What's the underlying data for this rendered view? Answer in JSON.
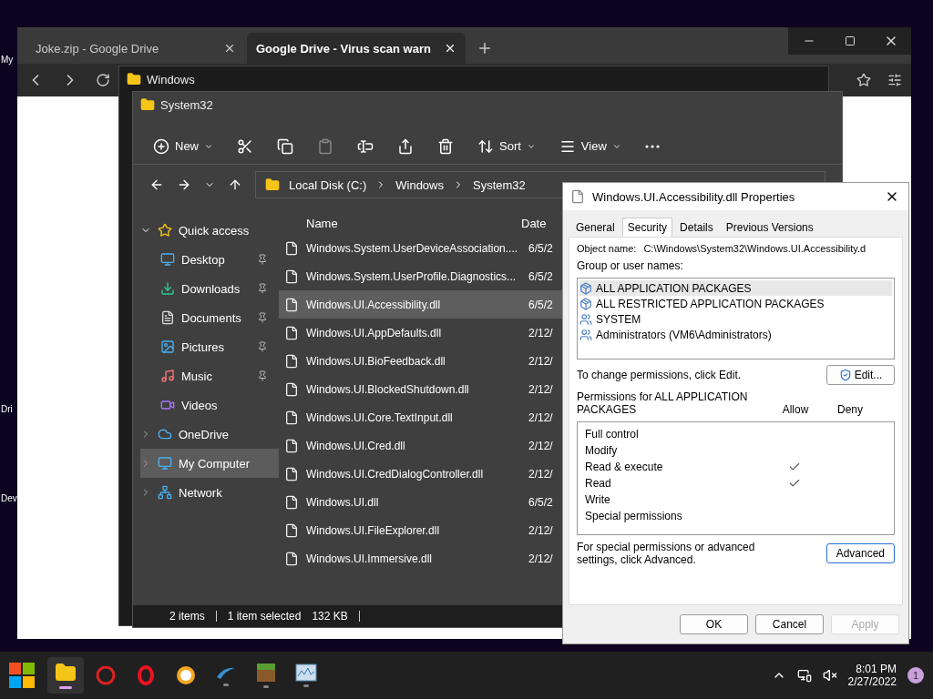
{
  "desktop": {
    "icons": [
      {
        "label": "My"
      },
      {
        "label": "Dri"
      },
      {
        "label": "Dev"
      }
    ]
  },
  "browser": {
    "tabs": [
      {
        "title": "Joke.zip - Google Drive",
        "selected": false
      },
      {
        "title": "Google Drive - Virus scan warn",
        "selected": true
      }
    ]
  },
  "back_window": {
    "title": "Windows"
  },
  "explorer": {
    "title": "System32",
    "commands": [
      {
        "kind": "new",
        "label": "New"
      },
      {
        "kind": "cut"
      },
      {
        "kind": "copy"
      },
      {
        "kind": "paste",
        "disabled": true
      },
      {
        "kind": "rename"
      },
      {
        "kind": "share"
      },
      {
        "kind": "delete"
      },
      {
        "kind": "sort",
        "label": "Sort"
      },
      {
        "kind": "view",
        "label": "View"
      },
      {
        "kind": "more"
      }
    ],
    "breadcrumb": [
      "Local Disk (C:)",
      "Windows",
      "System32"
    ],
    "sidebar": [
      {
        "kind": "star",
        "label": "Quick access",
        "expanded": true,
        "selected": false,
        "children": [
          {
            "kind": "desktop",
            "label": "Desktop",
            "pinned": true
          },
          {
            "kind": "downloads",
            "label": "Downloads",
            "pinned": true
          },
          {
            "kind": "documents",
            "label": "Documents",
            "pinned": true
          },
          {
            "kind": "pictures",
            "label": "Pictures",
            "pinned": true
          },
          {
            "kind": "music",
            "label": "Music",
            "pinned": true
          },
          {
            "kind": "videos",
            "label": "Videos",
            "pinned": false
          }
        ]
      },
      {
        "kind": "cloud",
        "label": "OneDrive",
        "expanded": false,
        "selected": false
      },
      {
        "kind": "computer",
        "label": "My Computer",
        "expanded": false,
        "selected": true
      },
      {
        "kind": "network",
        "label": "Network",
        "expanded": false,
        "selected": false
      }
    ],
    "columns": [
      "Name",
      "Date"
    ],
    "files": [
      {
        "name": "Windows.System.UserDeviceAssociation....",
        "date": "6/5/2",
        "selected": false
      },
      {
        "name": "Windows.System.UserProfile.Diagnostics...",
        "date": "6/5/2",
        "selected": false
      },
      {
        "name": "Windows.UI.Accessibility.dll",
        "date": "6/5/2",
        "selected": true
      },
      {
        "name": "Windows.UI.AppDefaults.dll",
        "date": "2/12/",
        "selected": false
      },
      {
        "name": "Windows.UI.BioFeedback.dll",
        "date": "2/12/",
        "selected": false
      },
      {
        "name": "Windows.UI.BlockedShutdown.dll",
        "date": "2/12/",
        "selected": false
      },
      {
        "name": "Windows.UI.Core.TextInput.dll",
        "date": "2/12/",
        "selected": false
      },
      {
        "name": "Windows.UI.Cred.dll",
        "date": "2/12/",
        "selected": false
      },
      {
        "name": "Windows.UI.CredDialogController.dll",
        "date": "2/12/",
        "selected": false
      },
      {
        "name": "Windows.UI.dll",
        "date": "6/5/2",
        "selected": false
      },
      {
        "name": "Windows.UI.FileExplorer.dll",
        "date": "2/12/",
        "selected": false
      },
      {
        "name": "Windows.UI.Immersive.dll",
        "date": "2/12/",
        "selected": false
      }
    ],
    "status": [
      "2 items",
      "1 item selected",
      "132 KB"
    ]
  },
  "dialog": {
    "title": "Windows.UI.Accessibility.dll Properties",
    "tabs": [
      {
        "label": "General",
        "selected": false
      },
      {
        "label": "Security",
        "selected": true
      },
      {
        "label": "Details",
        "selected": false
      },
      {
        "label": "Previous Versions",
        "selected": false
      }
    ],
    "object_label": "Object name:",
    "object_value": "C:\\Windows\\System32\\Windows.UI.Accessibility.d",
    "group_label": "Group or user names:",
    "groups": [
      {
        "kind": "package",
        "name": "ALL APPLICATION PACKAGES",
        "selected": true
      },
      {
        "kind": "package",
        "name": "ALL RESTRICTED APPLICATION PACKAGES",
        "selected": false
      },
      {
        "kind": "users",
        "name": "SYSTEM",
        "selected": false
      },
      {
        "kind": "users",
        "name": "Administrators (VM6\\Administrators)",
        "selected": false
      }
    ],
    "change_hint": "To change permissions, click Edit.",
    "edit_button": "Edit...",
    "perm_label": "Permissions for ALL APPLICATION PACKAGES",
    "allow_label": "Allow",
    "deny_label": "Deny",
    "permissions": [
      {
        "name": "Full control",
        "allow": false,
        "deny": false
      },
      {
        "name": "Modify",
        "allow": false,
        "deny": false
      },
      {
        "name": "Read & execute",
        "allow": true,
        "deny": false
      },
      {
        "name": "Read",
        "allow": true,
        "deny": false
      },
      {
        "name": "Write",
        "allow": false,
        "deny": false
      },
      {
        "name": "Special permissions",
        "allow": false,
        "deny": false
      }
    ],
    "advanced_hint": "For special permissions or advanced settings, click Advanced.",
    "advanced_button": "Advanced",
    "buttons": [
      {
        "label": "OK",
        "disabled": false
      },
      {
        "label": "Cancel",
        "disabled": false
      },
      {
        "label": "Apply",
        "disabled": true
      }
    ]
  },
  "taskbar": {
    "apps": [
      {
        "kind": "explorer",
        "selected": true,
        "running": true
      },
      {
        "kind": "gear",
        "selected": false,
        "running": false
      },
      {
        "kind": "opera",
        "selected": false,
        "running": false
      },
      {
        "kind": "shield",
        "selected": false,
        "running": false
      },
      {
        "kind": "edge",
        "selected": false,
        "running": true
      },
      {
        "kind": "block",
        "selected": false,
        "running": true
      },
      {
        "kind": "monitor",
        "selected": false,
        "running": true
      }
    ],
    "time": "8:01 PM",
    "date": "2/27/2022",
    "badge": "1"
  }
}
